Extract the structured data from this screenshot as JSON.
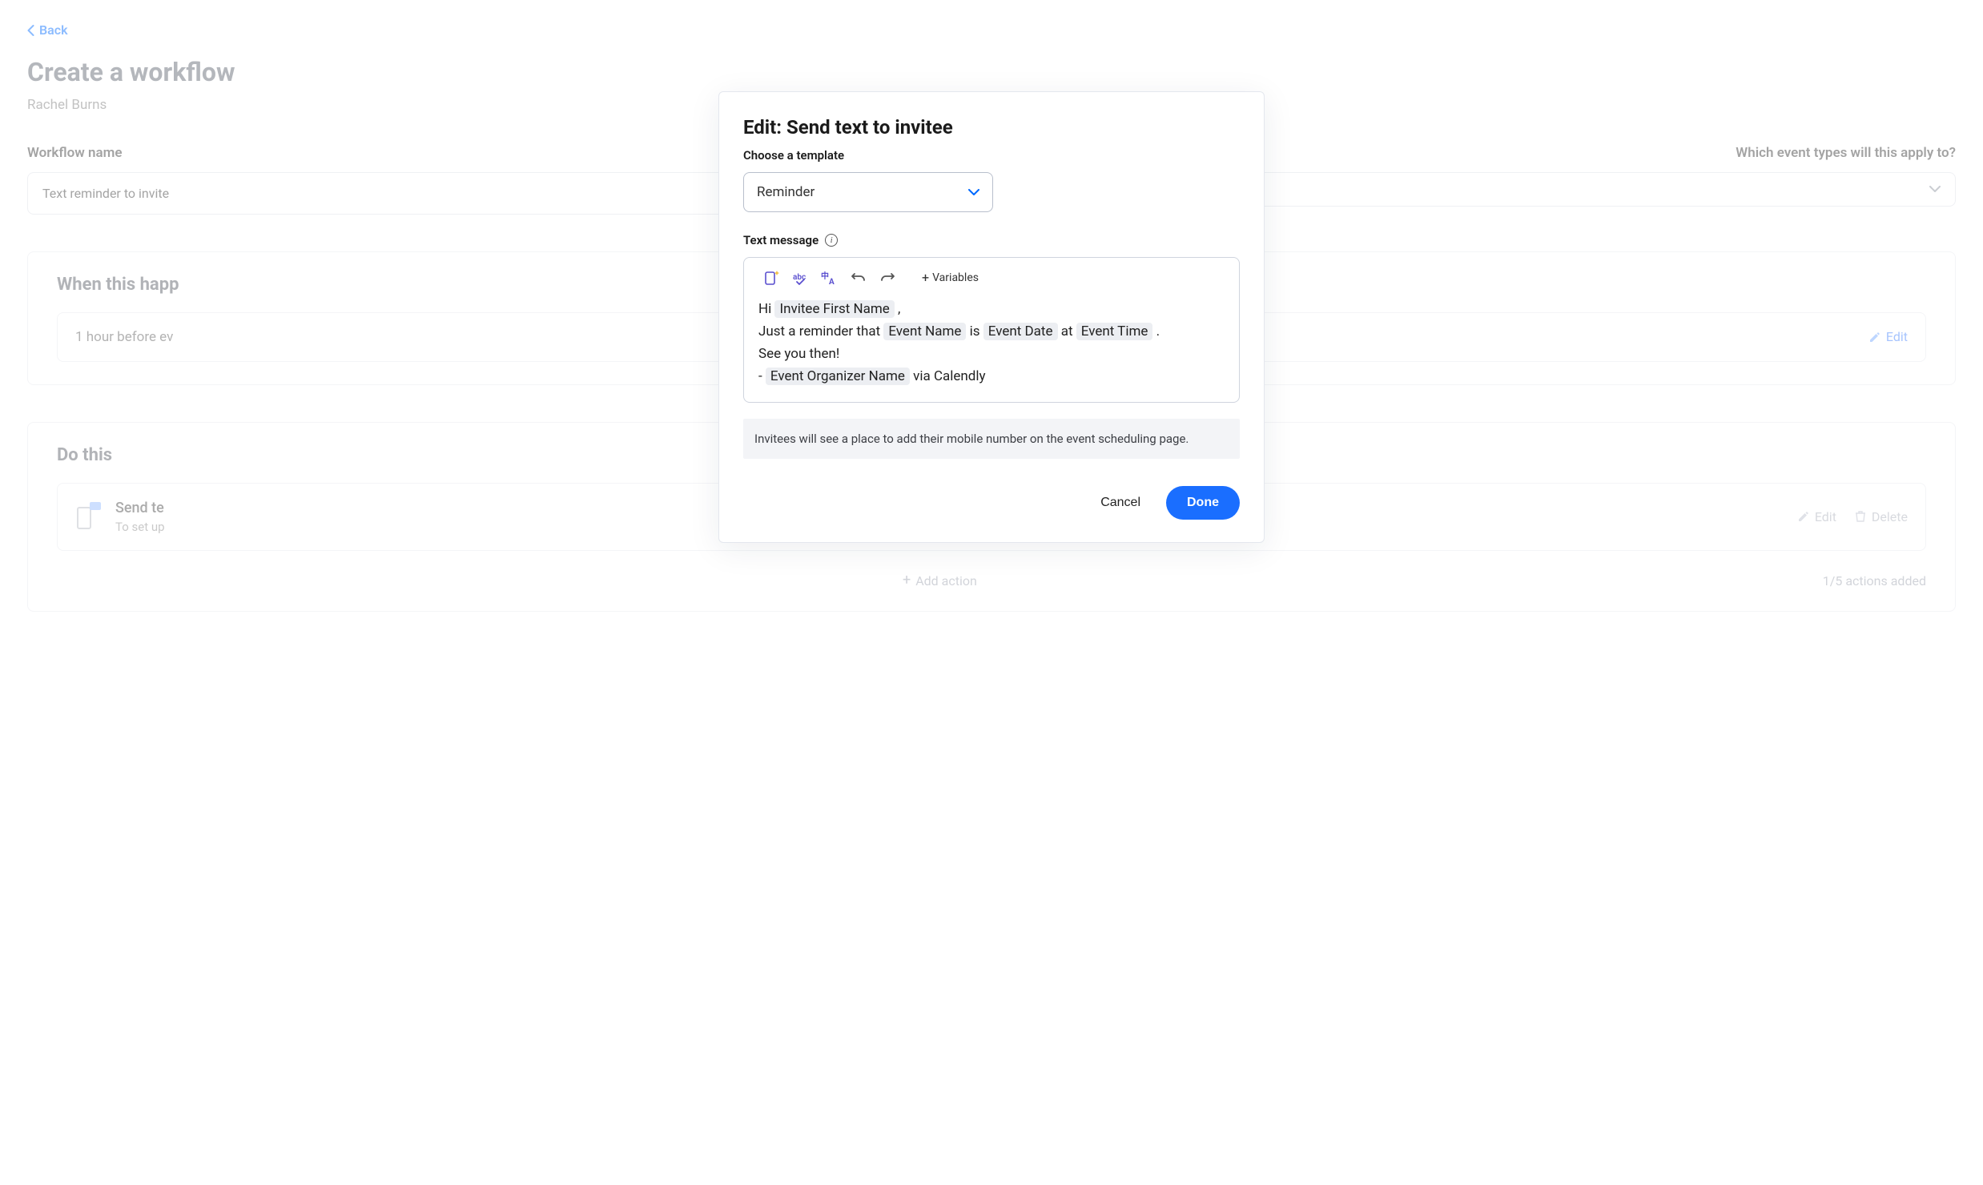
{
  "page": {
    "back_label": "Back",
    "title": "Create a workflow",
    "subtitle": "Rachel Burns",
    "workflow_name_label": "Workflow name",
    "workflow_name_value": "Text reminder to invite",
    "apply_to_label": "Which event types will this apply to?",
    "trigger_section_heading": "When this happ",
    "trigger_text": "1 hour before ev",
    "trigger_edit": "Edit",
    "actions_section_heading": "Do this",
    "action_title": "Send te",
    "action_sub": "To set up",
    "action_edit": "Edit",
    "action_delete": "Delete",
    "add_action": "Add action",
    "actions_count": "1/5 actions added"
  },
  "modal": {
    "title": "Edit: Send text to invitee",
    "choose_template": "Choose a template",
    "template_selected": "Reminder",
    "field_label": "Text message",
    "variables_btn": "Variables",
    "message": {
      "line1_prefix": "Hi ",
      "var_first_name": "Invitee First Name",
      "line1_suffix": " ,",
      "line2_prefix": "Just a reminder that ",
      "var_event_name": "Event Name",
      "line2_is": " is ",
      "var_event_date": "Event Date",
      "line2_at": " at ",
      "var_event_time": "Event Time",
      "line2_suffix": " .",
      "line3": "See you then!",
      "line4_prefix": "- ",
      "var_organizer": "Event Organizer Name",
      "line4_suffix": " via Calendly"
    },
    "hint": "Invitees will see a place to add their mobile number on the event scheduling page.",
    "cancel": "Cancel",
    "done": "Done"
  }
}
